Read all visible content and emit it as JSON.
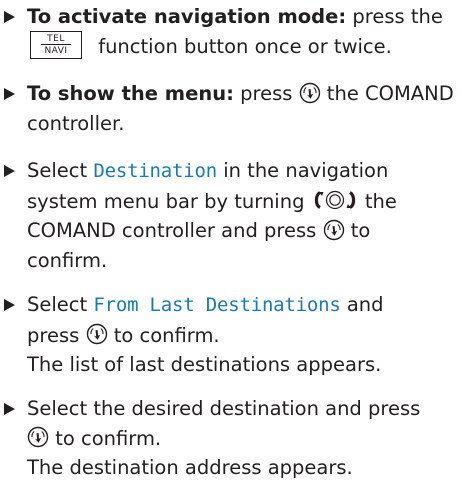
{
  "steps": [
    {
      "bold": "To activate navigation mode:",
      "t1": " press the",
      "key_top": "TEL",
      "key_bottom": "NAVI",
      "t2": " function button once or twice."
    },
    {
      "bold": "To show the menu:",
      "t1": " press",
      "t2": " the COMAND",
      "t3": "controller."
    },
    {
      "t1": "Select ",
      "mono": "Destination",
      "t2": " in the navigation",
      "t3": "system menu bar by turning",
      "t4": " the",
      "t5": "COMAND controller and press",
      "t6": " to",
      "t7": "confirm."
    },
    {
      "t1": "Select ",
      "mono": "From Last Destinations",
      "t2": " and",
      "t3": "press",
      "t4": " to confirm.",
      "t5": "The list of last destinations appears."
    },
    {
      "t1": "Select the desired destination and press",
      "t2": " to confirm.",
      "t3": "The destination address appears."
    }
  ],
  "icons": {
    "bullet": "triangle-bullet-icon",
    "press": "press-controller-icon",
    "turn": "turn-controller-icon",
    "key": "tel-navi-function-button-icon"
  },
  "colors": {
    "text": "#231f20",
    "display_text": "#1b7bb0"
  }
}
